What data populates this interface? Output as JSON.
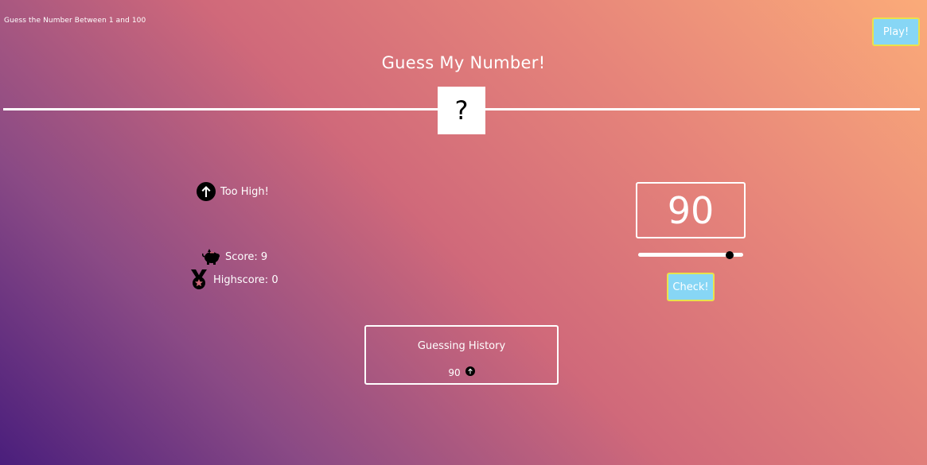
{
  "header": {
    "hint": "Guess the Number Between 1 and 100",
    "play_label": "Play!",
    "title": "Guess My Number!"
  },
  "secret": {
    "display": "?"
  },
  "status": {
    "feedback": "Too High!",
    "feedback_icon": "arrow-up-circle-icon",
    "score_label": "Score: 9",
    "score_icon": "piggy-bank-icon",
    "highscore_label": "Highscore: 0",
    "highscore_icon": "medal-icon"
  },
  "input": {
    "guess_value": "90",
    "slider_value": 90,
    "slider_min": 1,
    "slider_max": 100,
    "check_label": "Check!"
  },
  "history": {
    "title": "Guessing History",
    "entries": [
      {
        "value": "90",
        "icon": "arrow-up-circle-icon"
      }
    ]
  },
  "colors": {
    "accent_button": "#87d6f5",
    "button_border": "#e9e24a",
    "gradient_start": "#4a1e7c",
    "gradient_end": "#fbab79"
  }
}
